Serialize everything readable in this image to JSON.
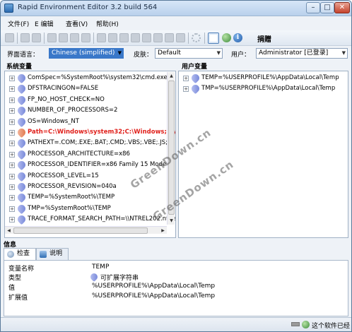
{
  "window": {
    "title": "Rapid Environment Editor 3.2 build 564"
  },
  "menu": [
    "文件(F)",
    "E 编辑",
    "查看(V)",
    "帮助(H)"
  ],
  "toolbar": {
    "donate_label": "捐赠"
  },
  "options": {
    "language_label": "界面语言：",
    "language_value": "Chinese (simplified)",
    "skin_label": "皮肤：",
    "skin_value": "Default",
    "user_label": "用户：",
    "user_value": "Administrator [已登录]"
  },
  "system_vars": {
    "title": "系统变量",
    "items": [
      {
        "text": "ComSpec=%SystemRoot%\\system32\\cmd.exe",
        "error": false
      },
      {
        "text": "DFSTRACINGON=FALSE",
        "error": false
      },
      {
        "text": "FP_NO_HOST_CHECK=NO",
        "error": false
      },
      {
        "text": "NUMBER_OF_PROCESSORS=2",
        "error": false
      },
      {
        "text": "OS=Windows_NT",
        "error": false
      },
      {
        "text": "Path=C:\\Windows\\system32;C:\\Windows;C:\\",
        "error": true
      },
      {
        "text": "PATHEXT=.COM;.EXE;.BAT;.CMD;.VBS;.VBE;.JS;.JS",
        "error": false
      },
      {
        "text": "PROCESSOR_ARCHITECTURE=x86",
        "error": false
      },
      {
        "text": "PROCESSOR_IDENTIFIER=x86 Family 15 Model 4 S",
        "error": false
      },
      {
        "text": "PROCESSOR_LEVEL=15",
        "error": false
      },
      {
        "text": "PROCESSOR_REVISION=040a",
        "error": false
      },
      {
        "text": "TEMP=%SystemRoot%\\TEMP",
        "error": false
      },
      {
        "text": "TMP=%SystemRoot%\\TEMP",
        "error": false
      },
      {
        "text": "TRACE_FORMAT_SEARCH_PATH=\\\\NTREL202.ntde",
        "error": false
      }
    ]
  },
  "user_vars": {
    "title": "用户变量",
    "items": [
      {
        "text": "TEMP=%USERPROFILE%\\AppData\\Local\\Temp"
      },
      {
        "text": "TMP=%USERPROFILE%\\AppData\\Local\\Temp"
      }
    ]
  },
  "info": {
    "title": "信息",
    "tabs": [
      "检查",
      "说明"
    ],
    "rows": [
      {
        "key": "变量名称",
        "value": "TEMP"
      },
      {
        "key": "类型",
        "value": "可扩展字符串"
      },
      {
        "key": "值",
        "value": "%USERPROFILE%\\AppData\\Local\\Temp"
      },
      {
        "key": "扩展值",
        "value": "%USERPROFILE%\\AppData\\Local\\Temp"
      }
    ]
  },
  "status": {
    "text": "这个软件已经"
  },
  "watermarks": [
    "GreenDown.cn",
    "GreenDown.cn"
  ]
}
